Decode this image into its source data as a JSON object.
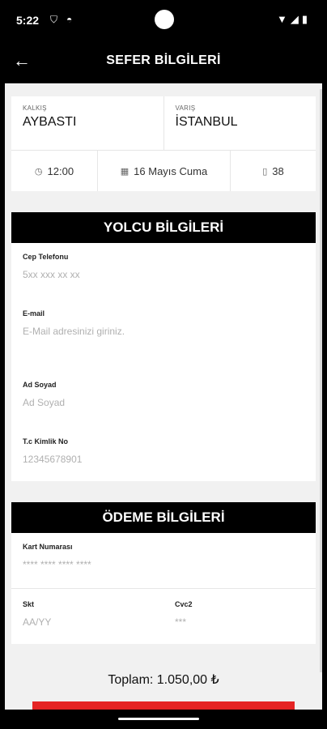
{
  "status_bar": {
    "time": "5:22"
  },
  "app_bar": {
    "title": "SEFER BİLGİLERİ"
  },
  "route": {
    "departure_label": "KALKIŞ",
    "departure_city": "AYBASTI",
    "arrival_label": "VARIŞ",
    "arrival_city": "İSTANBUL",
    "time": "12:00",
    "date": "16 Mayıs Cuma",
    "seat": "38"
  },
  "passenger": {
    "header": "YOLCU BİLGİLERİ",
    "phone_label": "Cep Telefonu",
    "phone_placeholder": "5xx xxx xx xx",
    "email_label": "E-mail",
    "email_placeholder": "E-Mail adresinizi giriniz.",
    "name_label": "Ad Soyad",
    "name_placeholder": "Ad Soyad",
    "tc_label": "T.c Kimlik No",
    "tc_placeholder": "12345678901"
  },
  "payment": {
    "header": "ÖDEME BİLGİLERİ",
    "card_label": "Kart Numarası",
    "card_placeholder": "**** **** **** ****",
    "expiry_label": "Skt",
    "expiry_placeholder": "AA/YY",
    "cvc_label": "Cvc2",
    "cvc_placeholder": "***"
  },
  "total": "Toplam: 1.050,00 ₺",
  "colors": {
    "pay_button": "#e52424",
    "header_bg": "#000000"
  }
}
